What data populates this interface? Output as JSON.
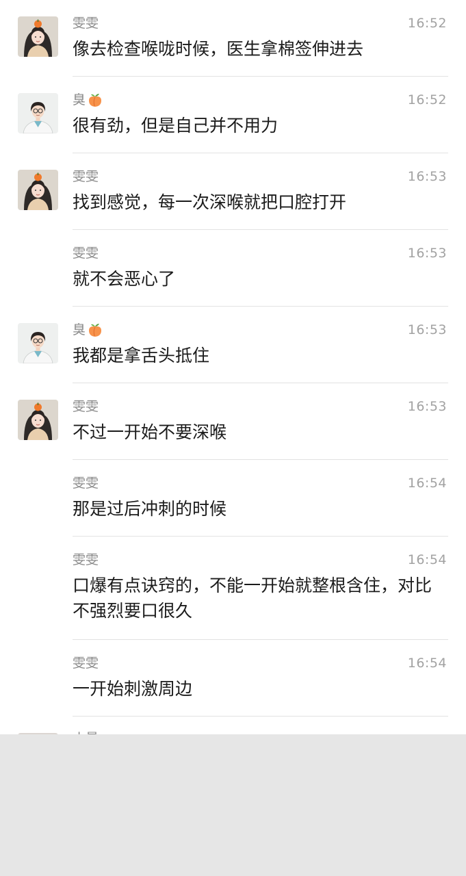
{
  "messages": [
    {
      "sender": "雯雯",
      "time": "16:52",
      "text": "像去检查喉咙时候，医生拿棉签伸进去",
      "avatar": "girl-avatar"
    },
    {
      "sender": "臭",
      "time": "16:52",
      "text": "很有劲，但是自己并不用力",
      "avatar": "doctor-avatar",
      "emoji": "peach-icon"
    },
    {
      "sender": "雯雯",
      "time": "16:53",
      "text": "找到感觉，每一次深喉就把口腔打开",
      "avatar": "girl-avatar"
    },
    {
      "sender": "雯雯",
      "time": "16:53",
      "text": "就不会恶心了",
      "avatar": null
    },
    {
      "sender": "臭",
      "time": "16:53",
      "text": "我都是拿舌头抵住",
      "avatar": "doctor-avatar",
      "emoji": "peach-icon"
    },
    {
      "sender": "雯雯",
      "time": "16:53",
      "text": "不过一开始不要深喉",
      "avatar": "girl-avatar"
    },
    {
      "sender": "雯雯",
      "time": "16:54",
      "text": "那是过后冲刺的时候",
      "avatar": null
    },
    {
      "sender": "雯雯",
      "time": "16:54",
      "text": "口爆有点诀窍的，不能一开始就整根含住，对比不强烈要口很久",
      "avatar": null
    },
    {
      "sender": "雯雯",
      "time": "16:54",
      "text": "一开始刺激周边",
      "avatar": null
    }
  ],
  "partial_message": {
    "sender": "小曼",
    "avatar": "woman-avatar"
  },
  "colors": {
    "background": "#ffffff",
    "lower_area": "#e6e6e6",
    "name": "#8a8a8a",
    "time": "#a2a2a2",
    "text": "#1b1b1b",
    "divider": "#e2e2e2"
  }
}
